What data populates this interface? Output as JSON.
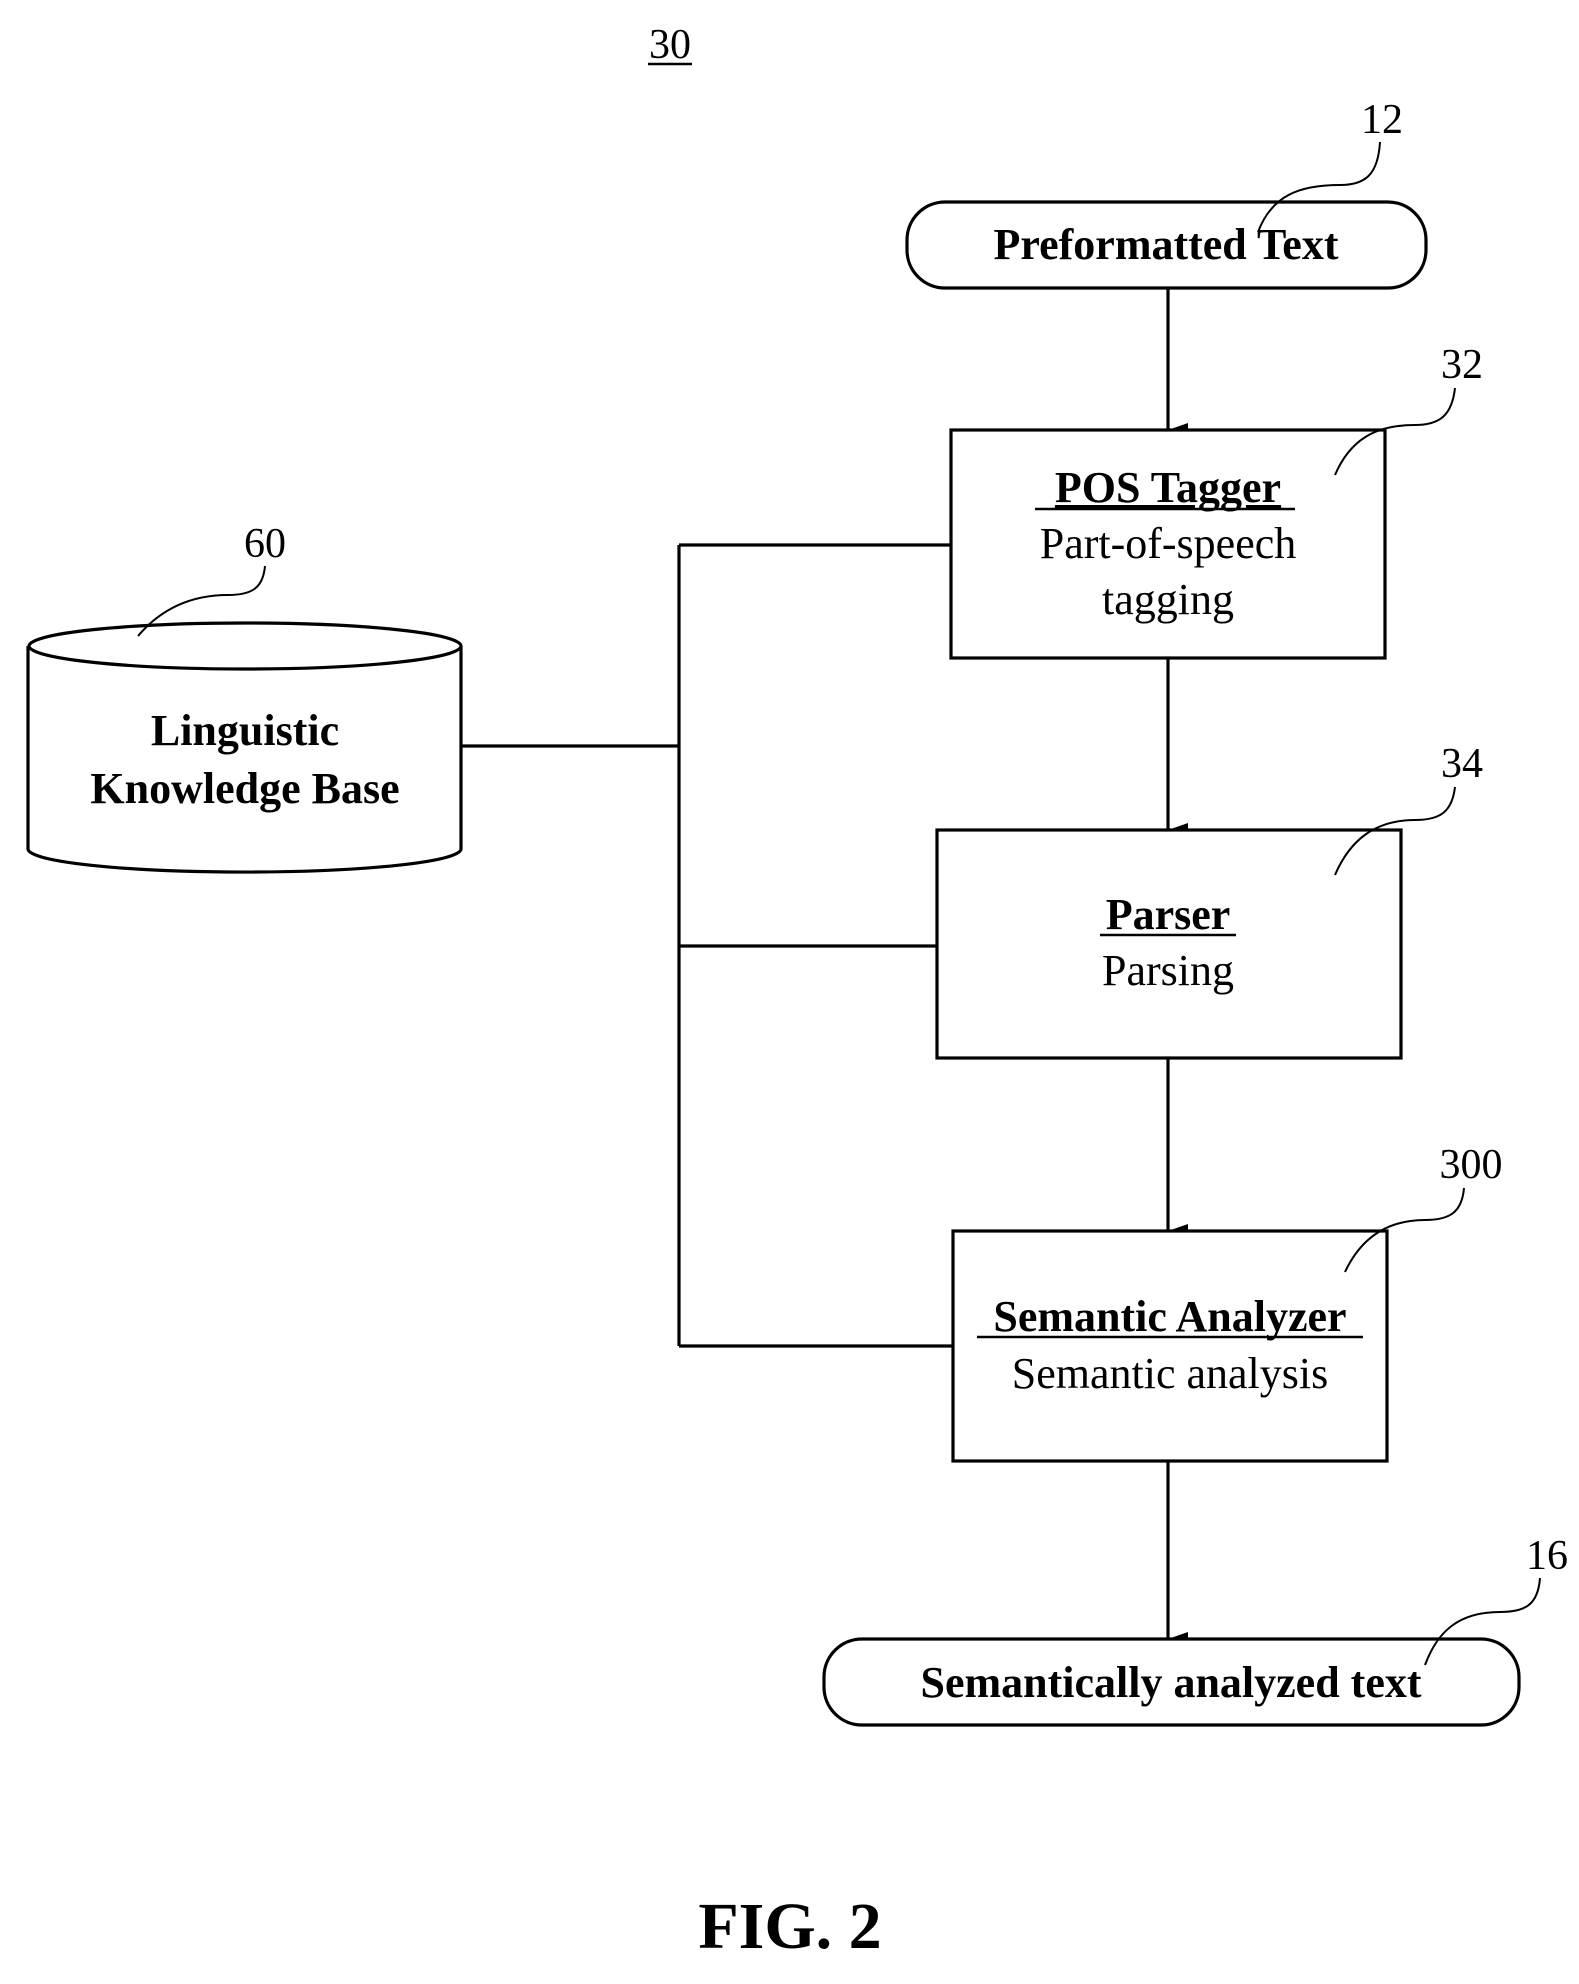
{
  "figure": {
    "reference_number": "30",
    "caption": "FIG. 2"
  },
  "nodes": {
    "input": {
      "ref": "12",
      "label": "Preformatted Text"
    },
    "pos_tagger": {
      "ref": "32",
      "title": "POS Tagger",
      "line1": "Part-of-speech",
      "line2": "tagging"
    },
    "parser": {
      "ref": "34",
      "title": "Parser",
      "line1": "Parsing"
    },
    "semantic_analyzer": {
      "ref": "300",
      "title": "Semantic Analyzer",
      "line1": "Semantic analysis"
    },
    "output": {
      "ref": "16",
      "label": "Semantically analyzed text"
    },
    "knowledge_base": {
      "ref": "60",
      "line1": "Linguistic",
      "line2": "Knowledge Base"
    }
  },
  "edges": [
    {
      "from": "input",
      "to": "pos_tagger",
      "type": "arrow"
    },
    {
      "from": "pos_tagger",
      "to": "parser",
      "type": "arrow"
    },
    {
      "from": "parser",
      "to": "semantic_analyzer",
      "type": "arrow"
    },
    {
      "from": "semantic_analyzer",
      "to": "output",
      "type": "arrow"
    },
    {
      "from": "knowledge_base",
      "to": "pos_tagger",
      "type": "line"
    },
    {
      "from": "knowledge_base",
      "to": "parser",
      "type": "line"
    },
    {
      "from": "knowledge_base",
      "to": "semantic_analyzer",
      "type": "line"
    }
  ]
}
